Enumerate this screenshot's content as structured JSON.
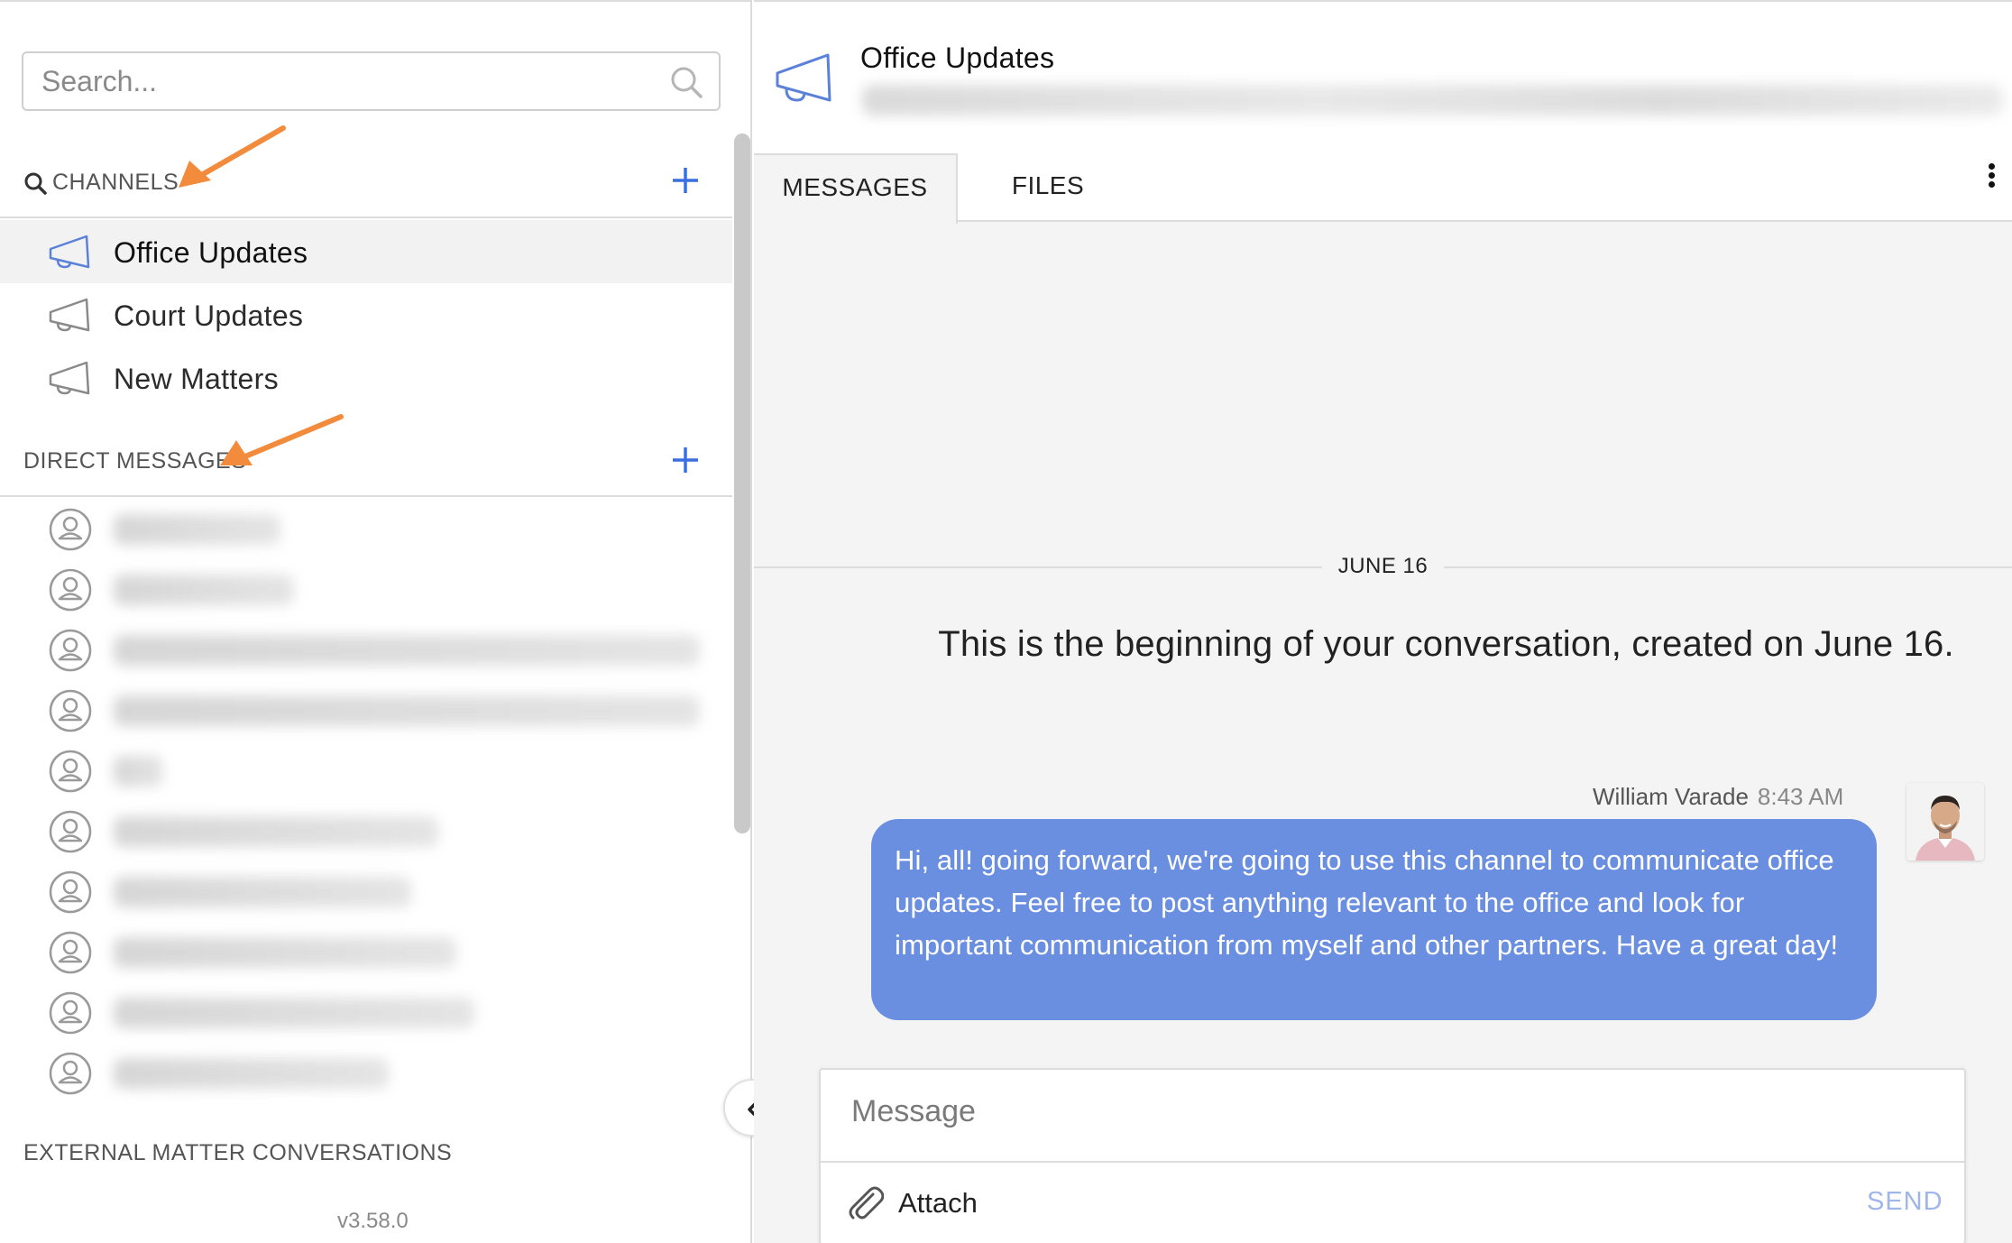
{
  "sidebar": {
    "search_placeholder": "Search...",
    "channels_header": "CHANNELS",
    "channels": [
      {
        "label": "Office Updates",
        "active": true
      },
      {
        "label": "Court Updates",
        "active": false
      },
      {
        "label": "New Matters",
        "active": false
      }
    ],
    "direct_messages_header": "DIRECT MESSAGES",
    "external_header": "EXTERNAL MATTER CONVERSATIONS",
    "version": "v3.58.0"
  },
  "channel": {
    "title": "Office Updates"
  },
  "tabs": [
    {
      "label": "MESSAGES",
      "active": true
    },
    {
      "label": "FILES",
      "active": false
    }
  ],
  "conversation": {
    "date_label": "JUNE 16",
    "intro_text": "This is the beginning of your conversation, created on June 16.",
    "message": {
      "author": "William Varade",
      "time": "8:43 AM",
      "text": "Hi, all! going forward, we're going to use this channel to communicate office updates. Feel free to post anything relevant to the office and look for important communication from myself and other partners. Have a great day!"
    }
  },
  "composer": {
    "placeholder": "Message",
    "attach_label": "Attach",
    "send_label": "SEND"
  },
  "colors": {
    "accent": "#3b6ee0",
    "bubble": "#6a8fe0",
    "arrow": "#f28c3c",
    "send_disabled": "#9fb6ea"
  }
}
